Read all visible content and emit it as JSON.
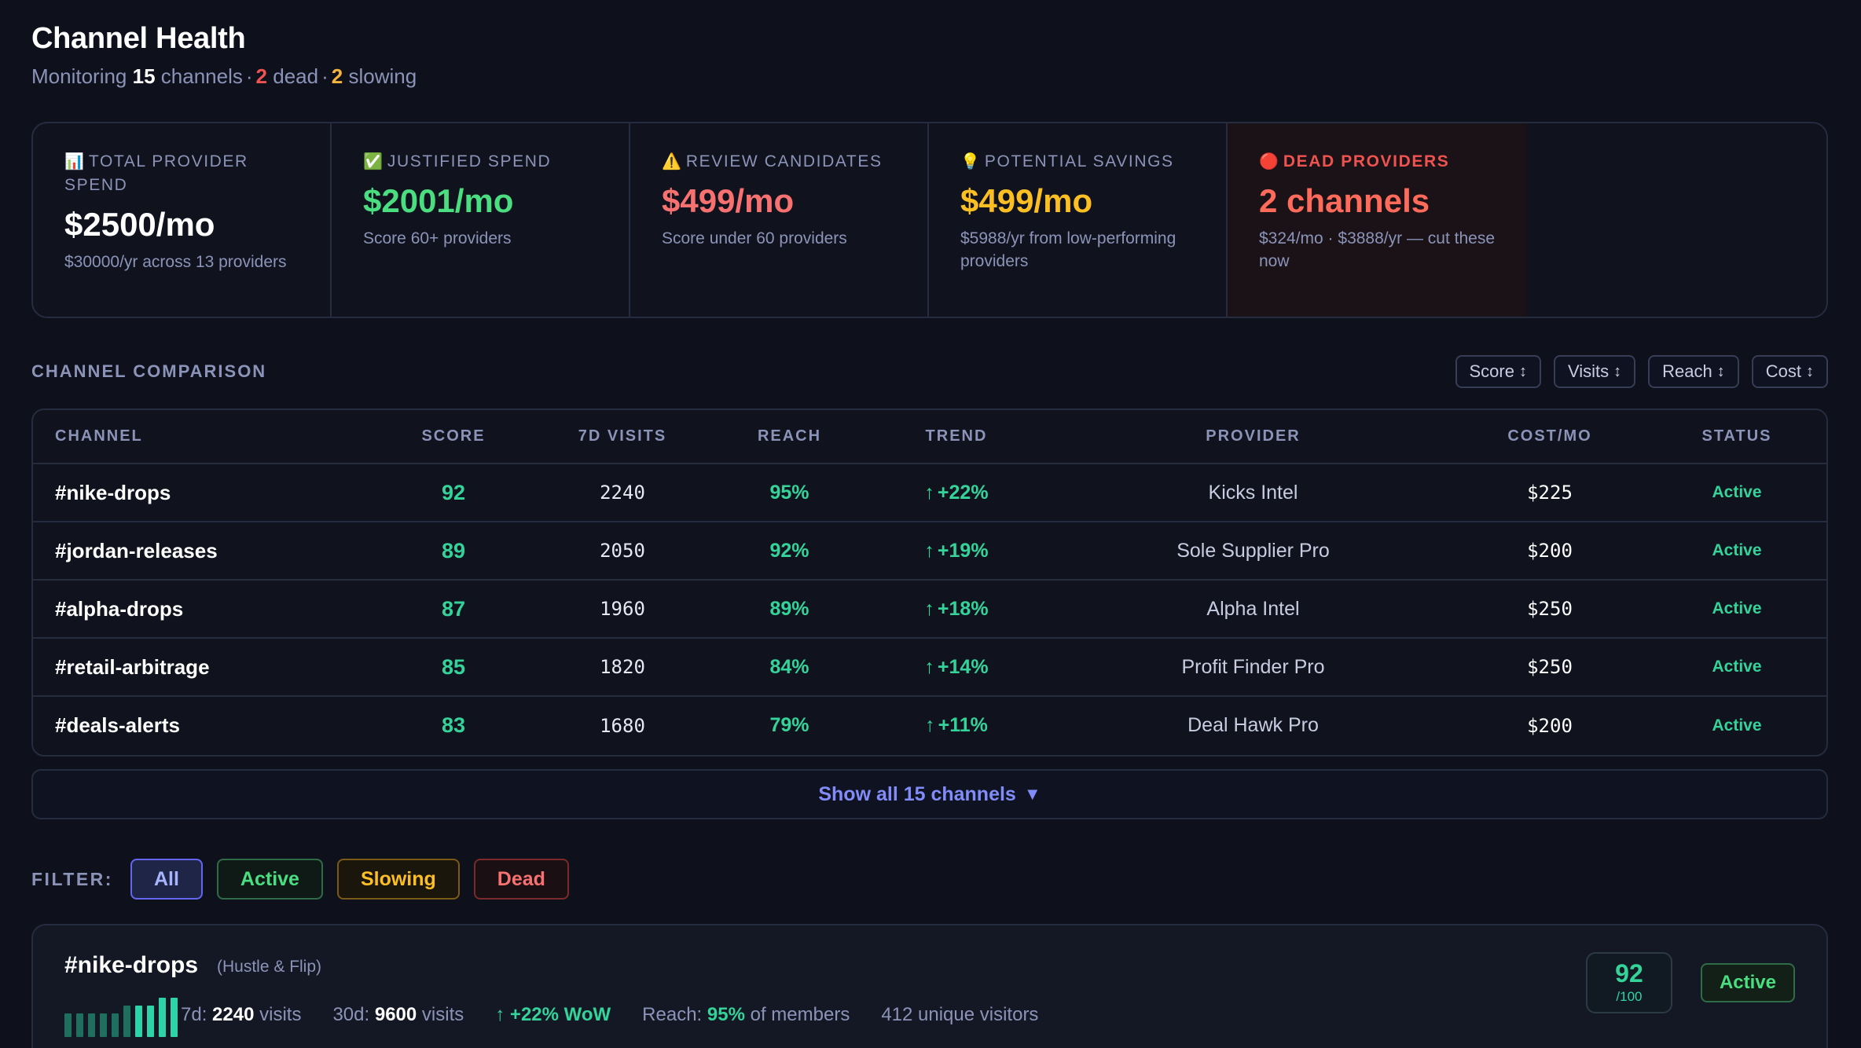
{
  "header": {
    "title": "Channel Health",
    "monitoring_prefix": "Monitoring",
    "channels_count": "15",
    "channels_word": "channels",
    "dead_count": "2",
    "dead_word": "dead",
    "slowing_count": "2",
    "slowing_word": "slowing",
    "separator": "·"
  },
  "stats": [
    {
      "icon": "📊",
      "label": "Total Provider Spend",
      "value": "$2500/mo",
      "note": "$30000/yr across 13 providers"
    },
    {
      "icon": "✅",
      "label": "Justified Spend",
      "value": "$2001/mo",
      "note": "Score 60+ providers"
    },
    {
      "icon": "⚠️",
      "label": "Review Candidates",
      "value": "$499/mo",
      "note": "Score under 60 providers"
    },
    {
      "icon": "💡",
      "label": "Potential Savings",
      "value": "$499/mo",
      "note": "$5988/yr from low-performing providers"
    },
    {
      "icon": "🔴",
      "label": "Dead Providers",
      "value": "2 channels",
      "note": "$324/mo · $3888/yr — cut these now"
    }
  ],
  "comparison": {
    "label": "CHANNEL COMPARISON",
    "sort_buttons": [
      "Score",
      "Visits",
      "Reach",
      "Cost"
    ],
    "sort_icon": "↕",
    "columns": [
      "CHANNEL",
      "SCORE",
      "7D VISITS",
      "REACH",
      "TREND",
      "PROVIDER",
      "COST/MO",
      "STATUS"
    ],
    "rows": [
      {
        "channel": "#nike-drops",
        "score": "92",
        "visits": "2240",
        "reach": "95%",
        "trend": "+22%",
        "provider": "Kicks Intel",
        "cost": "$225",
        "status": "Active"
      },
      {
        "channel": "#jordan-releases",
        "score": "89",
        "visits": "2050",
        "reach": "92%",
        "trend": "+19%",
        "provider": "Sole Supplier Pro",
        "cost": "$200",
        "status": "Active"
      },
      {
        "channel": "#alpha-drops",
        "score": "87",
        "visits": "1960",
        "reach": "89%",
        "trend": "+18%",
        "provider": "Alpha Intel",
        "cost": "$250",
        "status": "Active"
      },
      {
        "channel": "#retail-arbitrage",
        "score": "85",
        "visits": "1820",
        "reach": "84%",
        "trend": "+14%",
        "provider": "Profit Finder Pro",
        "cost": "$250",
        "status": "Active"
      },
      {
        "channel": "#deals-alerts",
        "score": "83",
        "visits": "1680",
        "reach": "79%",
        "trend": "+11%",
        "provider": "Deal Hawk Pro",
        "cost": "$200",
        "status": "Active"
      }
    ],
    "trend_arrow": "↑",
    "show_all_label": "Show all 15 channels",
    "show_all_icon": "▼"
  },
  "filter": {
    "label": "FILTER:",
    "options": [
      "All",
      "Active",
      "Slowing",
      "Dead"
    ],
    "selected": "All"
  },
  "detail": {
    "name": "#nike-drops",
    "group": "(Hustle & Flip)",
    "bars_relative": [
      0.6,
      0.6,
      0.6,
      0.6,
      0.6,
      0.8,
      0.8,
      0.8,
      1.0,
      1.0
    ],
    "visits_7d_label": "7d:",
    "visits_7d": "2240",
    "visits_30d_label": "30d:",
    "visits_30d": "9600",
    "visits_word": "visits",
    "trend": "+22% WoW",
    "reach_label": "Reach:",
    "reach_value": "95%",
    "reach_suffix": "of members",
    "unique": "412 unique visitors",
    "score": "92",
    "score_max": "/100",
    "status": "Active"
  }
}
